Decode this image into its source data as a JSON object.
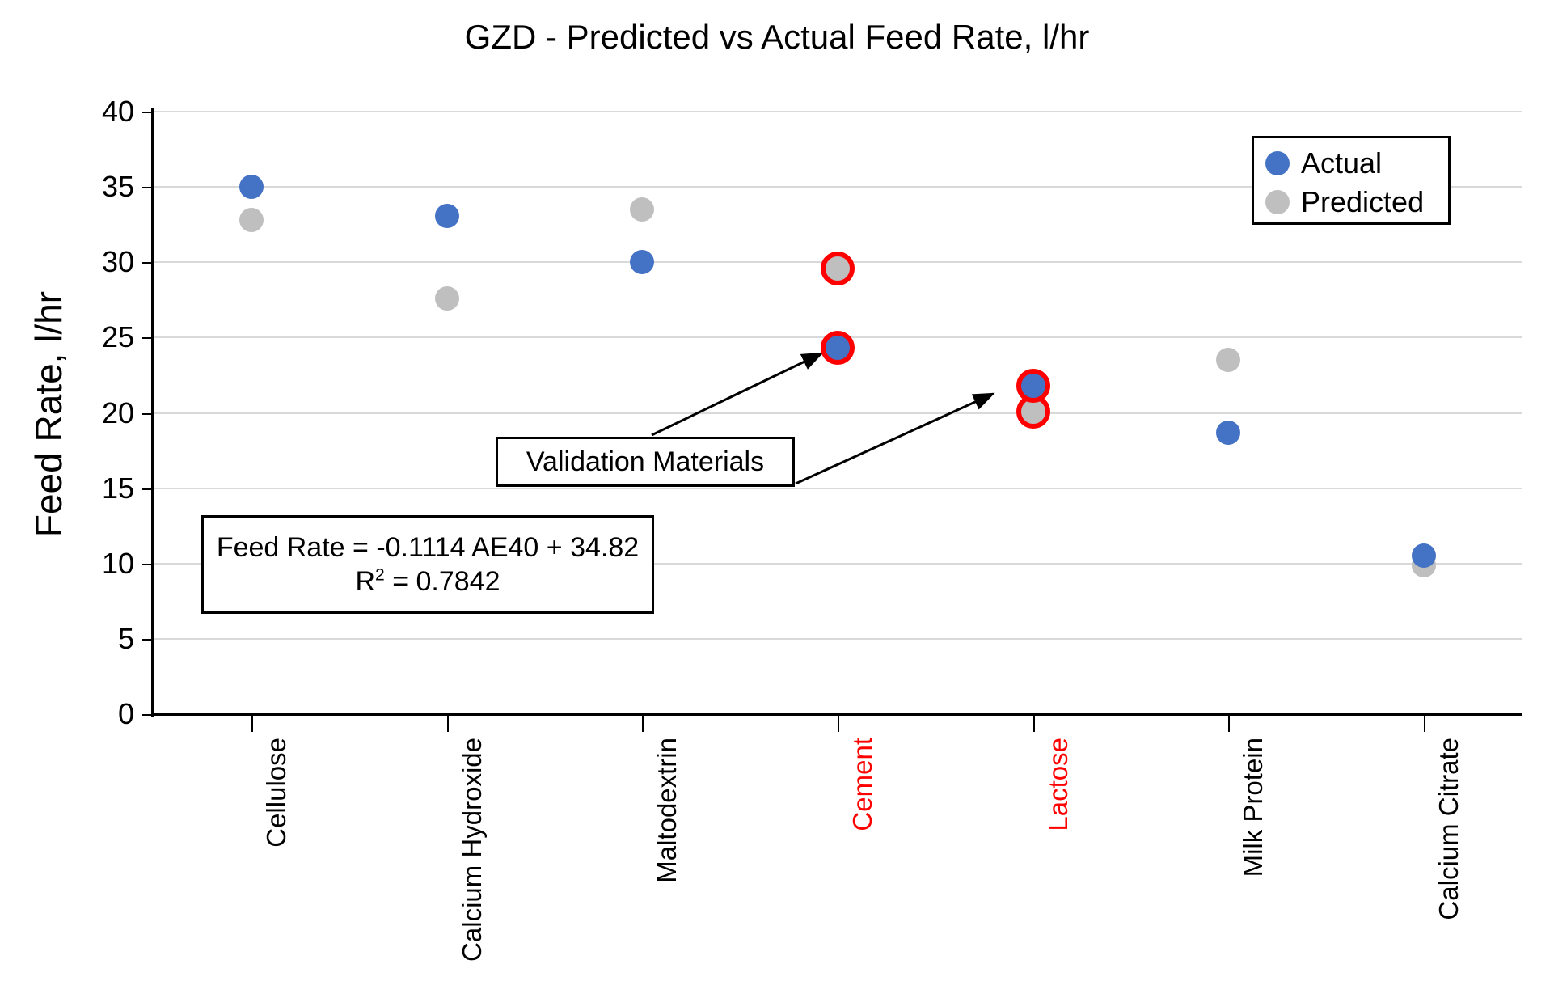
{
  "chart_data": {
    "type": "scatter",
    "title": "GZD - Predicted vs Actual Feed Rate, l/hr",
    "xlabel": "",
    "ylabel": "Feed Rate, l/hr",
    "ylim": [
      0,
      40
    ],
    "yticks": [
      0,
      5,
      10,
      15,
      20,
      25,
      30,
      35,
      40
    ],
    "grid": true,
    "legend_position": "top-right",
    "categories": [
      "Cellulose",
      "Calcium Hydroxide",
      "Maltodextrin",
      "Cement",
      "Lactose",
      "Milk Protein",
      "Calcium Citrate"
    ],
    "highlighted_categories": [
      "Cement",
      "Lactose"
    ],
    "series": [
      {
        "name": "Actual",
        "color": "#4472C4",
        "values": [
          35.0,
          33.1,
          30.0,
          24.3,
          21.8,
          18.7,
          10.5
        ]
      },
      {
        "name": "Predicted",
        "color": "#BFBFBF",
        "values": [
          32.8,
          27.6,
          33.5,
          29.6,
          20.1,
          23.5,
          9.9
        ]
      }
    ],
    "annotations": [
      {
        "label": "Validation Materials",
        "points": [
          "Cement",
          "Lactose"
        ]
      },
      {
        "label": "Feed Rate = -0.1114 AE40 + 34.82"
      },
      {
        "label": "R2 = 0.7842"
      }
    ]
  },
  "legend": {
    "items": [
      {
        "label": "Actual",
        "color": "#4472C4"
      },
      {
        "label": "Predicted",
        "color": "#BFBFBF"
      }
    ]
  },
  "equation": {
    "line1": "Feed Rate = -0.1114 AE40 + 34.82",
    "r2_prefix": "R",
    "r2_exponent": "2",
    "r2_value": " = 0.7842"
  },
  "callout": {
    "label": "Validation Materials"
  },
  "axis": {
    "y_title": "Feed Rate, l/hr",
    "y_ticks": [
      "40",
      "35",
      "30",
      "25",
      "20",
      "15",
      "10",
      "5",
      "0"
    ]
  },
  "colors": {
    "actual": "#4472C4",
    "predicted": "#BFBFBF",
    "highlight_ring": "#FF0000",
    "gridline": "#D9D9D9",
    "axis": "#000000"
  }
}
